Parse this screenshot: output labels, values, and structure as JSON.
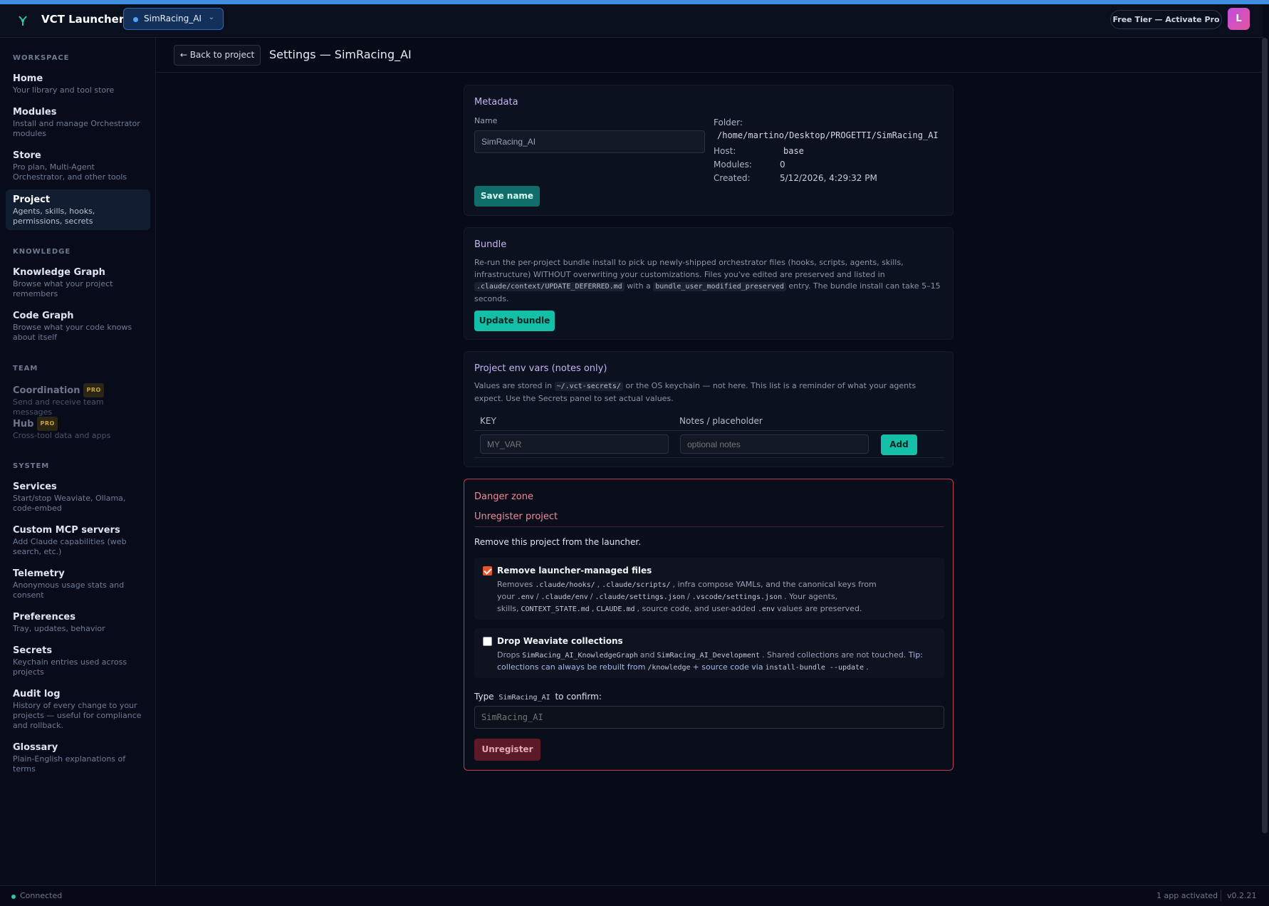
{
  "header": {
    "app_title": "VCT Launcher",
    "project_selector": "SimRacing_AI",
    "pro_button": "Free Tier — Activate Pro",
    "avatar_initial": "L"
  },
  "sidebar": {
    "sections": {
      "workspace": "WORKSPACE",
      "knowledge": "KNOWLEDGE",
      "team": "TEAM",
      "system": "SYSTEM"
    },
    "items": [
      {
        "label": "Home",
        "desc": "Your library and tool store"
      },
      {
        "label": "Modules",
        "desc": "Install and manage Orchestrator modules"
      },
      {
        "label": "Store",
        "desc": "Pro plan, Multi-Agent Orchestrator, and other tools"
      },
      {
        "label": "Project",
        "desc": "Agents, skills, hooks, permissions, secrets"
      },
      {
        "label": "Knowledge Graph",
        "desc": "Browse what your project remembers"
      },
      {
        "label": "Code Graph",
        "desc": "Browse what your code knows about itself"
      },
      {
        "label": "Coordination",
        "desc": "Send and receive team messages",
        "badge": "PRO"
      },
      {
        "label": "Hub",
        "desc": "Cross-tool data and apps",
        "badge": "PRO"
      },
      {
        "label": "Services",
        "desc": "Start/stop Weaviate, Ollama, code-embed"
      },
      {
        "label": "Custom MCP servers",
        "desc": "Add Claude capabilities (web search, etc.)"
      },
      {
        "label": "Telemetry",
        "desc": "Anonymous usage stats and consent"
      },
      {
        "label": "Preferences",
        "desc": "Tray, updates, behavior"
      },
      {
        "label": "Secrets",
        "desc": "Keychain entries used across projects"
      },
      {
        "label": "Audit log",
        "desc": "History of every change to your projects — useful for compliance and rollback."
      },
      {
        "label": "Glossary",
        "desc": "Plain-English explanations of terms"
      }
    ]
  },
  "subheader": {
    "back_label": "← Back to project",
    "title": "Settings — SimRacing_AI"
  },
  "metadata": {
    "title": "Metadata",
    "name_label": "Name",
    "name_value": "SimRacing_AI",
    "save_label": "Save name",
    "folder_key": "Folder:",
    "folder_value": "/home/martino/Desktop/PROGETTI/SimRacing_AI",
    "host_key": "Host:",
    "host_value": "base",
    "modules_key": "Modules:",
    "modules_value": "0",
    "created_key": "Created:",
    "created_value": "5/12/2026, 4:29:32 PM"
  },
  "bundle": {
    "title": "Bundle",
    "text1": "Re-run the per-project bundle install to pick up newly-shipped orchestrator files (hooks, scripts, agents, skills, infrastructure) WITHOUT overwriting your customizations. Files you've edited are preserved and listed in",
    "code1": ".claude/context/UPDATE_DEFERRED.md",
    "text2": "with a",
    "code2": "bundle_user_modified_preserved",
    "text3": "entry. The bundle install can take 5–15 seconds.",
    "button": "Update bundle"
  },
  "envvars": {
    "title": "Project env vars (notes only)",
    "text1": "Values are stored in",
    "code1": "~/.vct-secrets/",
    "text2": "or the OS keychain — not here. This list is a reminder of what your agents expect. Use the Secrets panel to set actual values.",
    "col_key": "KEY",
    "col_notes": "Notes / placeholder",
    "key_placeholder": "MY_VAR",
    "notes_placeholder": "optional notes",
    "add_label": "Add"
  },
  "danger": {
    "title": "Danger zone",
    "subtitle": "Unregister project",
    "desc": "Remove this project from the launcher.",
    "opt1": {
      "title": "Remove launcher-managed files",
      "checked": true,
      "t1": "Removes",
      "c1": ".claude/hooks/",
      "t2": ",",
      "c2": ".claude/scripts/",
      "t3": ", infra compose YAMLs, and the canonical keys from your",
      "c3": ".env",
      "t4": "/",
      "c4": ".claude/env",
      "t5": "/",
      "c5": ".claude/settings.json",
      "t6": "/",
      "c6": ".vscode/settings.json",
      "t7": ". Your agents, skills,",
      "c7": "CONTEXT_STATE.md",
      "t8": ",",
      "c8": "CLAUDE.md",
      "t9": ", source code, and user-added",
      "c9": ".env",
      "t10": "values are preserved."
    },
    "opt2": {
      "title": "Drop Weaviate collections",
      "checked": false,
      "t1": "Drops",
      "c1": "SimRacing_AI_KnowledgeGraph",
      "t2": "and",
      "c2": "SimRacing_AI_Development",
      "t3": ". Shared collections are not touched.",
      "tip1": "Tip: collections can always be rebuilt from",
      "c3": "/knowledge",
      "tip2": "+ source code via",
      "c4": "install-bundle --update",
      "tip3": "."
    },
    "confirm_pre": "Type",
    "confirm_code": "SimRacing_AI",
    "confirm_post": "to confirm:",
    "confirm_placeholder": "SimRacing_AI",
    "button": "Unregister"
  },
  "footer": {
    "status": "Connected",
    "activated": "1 app activated",
    "version": "v0.2.21"
  },
  "colors": {
    "accent_teal": "#13bfa6",
    "danger": "#c23a52",
    "brand_blue": "#3f8fe0"
  }
}
